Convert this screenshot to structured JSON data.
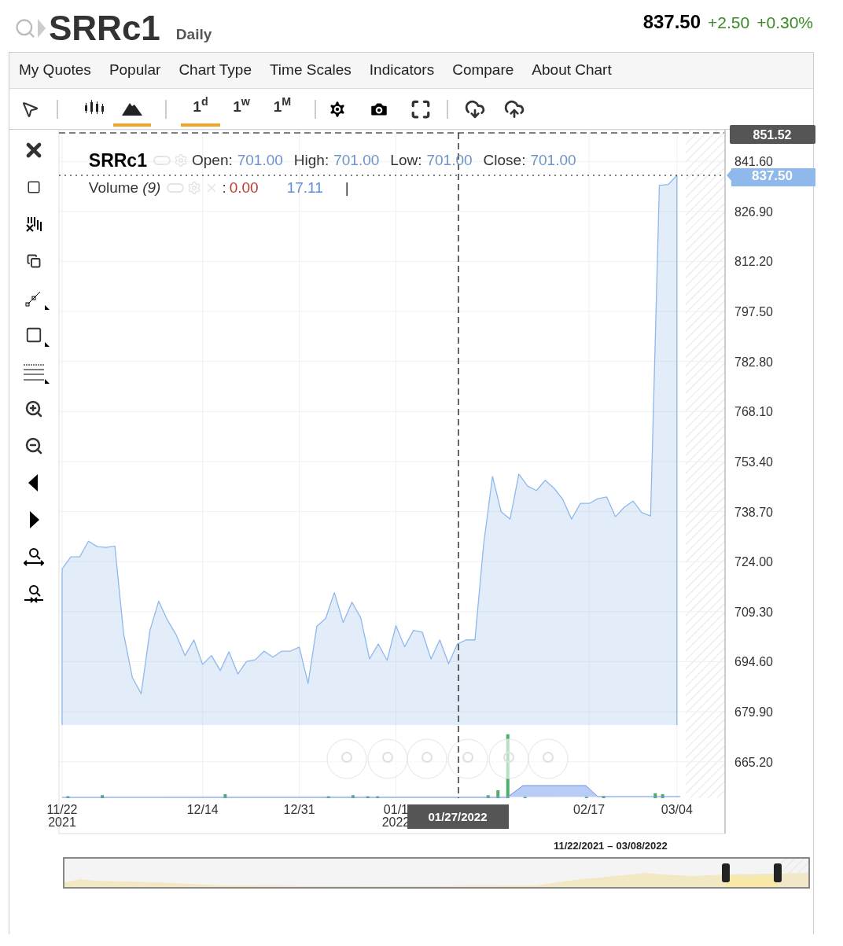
{
  "header": {
    "symbol": "SRRc1",
    "interval": "Daily",
    "price": "837.50",
    "change": "+2.50",
    "change_pct": "+0.30%"
  },
  "menu": [
    "My Quotes",
    "Popular",
    "Chart Type",
    "Time Scales",
    "Indicators",
    "Compare",
    "About Chart"
  ],
  "chart_styles": [
    {
      "selected": false
    },
    {
      "selected": true
    }
  ],
  "time_scales": [
    {
      "label": "1$^{d}$",
      "selected": true
    },
    {
      "label": "1$^{w}$",
      "selected": false
    },
    {
      "label": "1$^{M}$",
      "selected": false
    }
  ],
  "legend": {
    "symbol": "SRRc1",
    "fields": [
      {
        "label": "Open:",
        "value": "701.00"
      },
      {
        "label": "High:",
        "value": "701.00"
      },
      {
        "label": "Low:",
        "value": "701.00"
      },
      {
        "label": "Close:",
        "value": "701.00"
      }
    ]
  },
  "volume_legend": {
    "label": "Volume",
    "param": "(9)",
    "separator": ":",
    "value": "0.00",
    "average": "17.11",
    "marker": "|"
  },
  "crosshair": {
    "price": "851.52",
    "date": "01/27/2022"
  },
  "last_price": "837.50",
  "chart_data": {
    "type": "area",
    "categories": [
      "11/22\n2021",
      null,
      null,
      null,
      null,
      null,
      null,
      null,
      null,
      null,
      null,
      null,
      null,
      null,
      null,
      null,
      "12/14",
      null,
      null,
      null,
      null,
      null,
      null,
      null,
      null,
      null,
      null,
      "12/31",
      null,
      null,
      null,
      null,
      null,
      null,
      null,
      null,
      null,
      null,
      "01/1\n2022",
      null,
      null,
      null,
      null,
      null,
      null,
      null,
      null,
      null,
      null,
      null,
      null,
      null,
      null,
      null,
      null,
      null,
      null,
      null,
      null,
      null,
      "02/17",
      null,
      null,
      null,
      null,
      null,
      null,
      null,
      null,
      null,
      "03/04"
    ],
    "grid": true,
    "series": [
      {
        "color": "#8fb8ec",
        "values": [
          721.9,
          725.4,
          725.4,
          730.0,
          728.4,
          728.2,
          728.6,
          702.9,
          689.9,
          685.2,
          703.8,
          712.4,
          706.8,
          702.4,
          696.4,
          701.0,
          693.8,
          696.4,
          692.0,
          697.5,
          691.0,
          694.7,
          695.2,
          697.7,
          695.9,
          697.7,
          697.7,
          698.9,
          688.2,
          705.0,
          707.3,
          714.9,
          706.1,
          712.1,
          707.5,
          695.4,
          699.8,
          695.0,
          705.2,
          699.0,
          703.8,
          703.3,
          695.4,
          701.0,
          694.0,
          699.8,
          701.0,
          701.0,
          729.3,
          749.0,
          738.6,
          736.5,
          749.7,
          746.2,
          744.9,
          747.9,
          745.6,
          742.3,
          736.5,
          741.1,
          741.1,
          742.5,
          743.0,
          737.2,
          740.0,
          741.8,
          738.4,
          737.4,
          834.6,
          834.8,
          837.5
        ]
      }
    ],
    "ylim": [
      654.5,
      850.9
    ],
    "yticks": [
      {
        "value": 665.2,
        "label": "665.20"
      },
      {
        "value": 679.9,
        "label": "679.90"
      },
      {
        "value": 694.6,
        "label": "694.60"
      },
      {
        "value": 709.3,
        "label": "709.30"
      },
      {
        "value": 724.0,
        "label": "724.00"
      },
      {
        "value": 738.7,
        "label": "738.70"
      },
      {
        "value": 753.4,
        "label": "753.40"
      },
      {
        "value": 768.1,
        "label": "768.10"
      },
      {
        "value": 782.8,
        "label": "782.80"
      },
      {
        "value": 797.5,
        "label": "797.50"
      },
      {
        "value": 812.2,
        "label": "812.20"
      },
      {
        "value": 826.9,
        "label": "826.90"
      },
      {
        "value": 841.6,
        "label": "841.60"
      }
    ]
  },
  "navigator": {
    "range_start": "11/22/2021",
    "range_sep": "–",
    "range_end": "03/08/2022"
  }
}
